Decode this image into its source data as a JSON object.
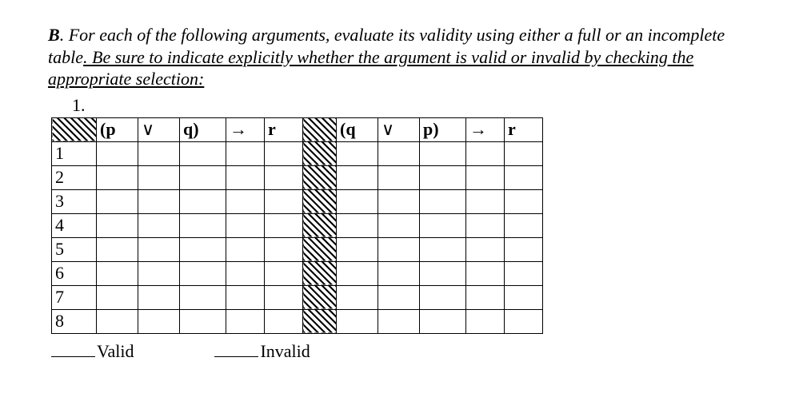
{
  "section_label": "B",
  "instructions_plain": ". For each of the following arguments, evaluate its validity using either a full or an incomplete table",
  "instructions_underlined": ". Be sure to indicate explicitly whether the argument is valid or invalid by checking the appropriate selection:",
  "problem_number": "1.",
  "headers_left": [
    "(p",
    "∨",
    "q)",
    "→",
    "r"
  ],
  "headers_right": [
    "(q",
    "∨",
    "p)",
    "→",
    "r"
  ],
  "bold_flags_left": [
    true,
    false,
    true,
    false,
    true
  ],
  "bold_flags_right": [
    true,
    false,
    true,
    false,
    true
  ],
  "row_labels": [
    "1",
    "2",
    "3",
    "4",
    "5",
    "6",
    "7",
    "8"
  ],
  "valid_label": "Valid",
  "invalid_label": "Invalid"
}
